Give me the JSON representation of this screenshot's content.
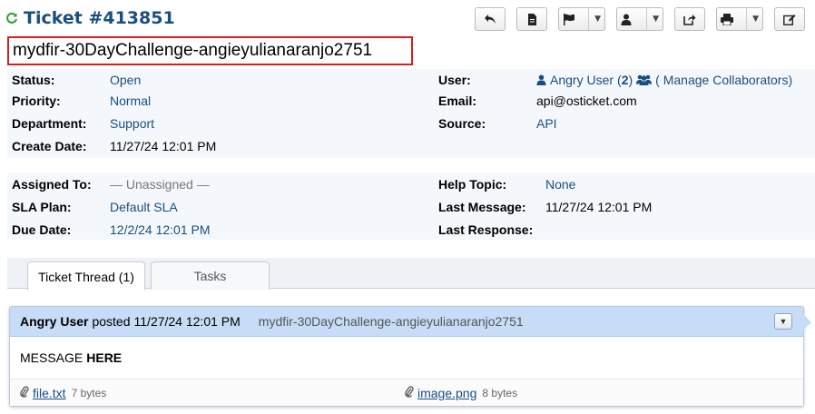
{
  "header": {
    "ticket_number": "Ticket #413851",
    "subject": "mydfir-30DayChallenge-angieyulianaranjo2751"
  },
  "info_left": [
    {
      "label": "Status:",
      "value": "Open"
    },
    {
      "label": "Priority:",
      "value": "Normal"
    },
    {
      "label": "Department:",
      "value": "Support"
    },
    {
      "label": "Create Date:",
      "value": "11/27/24 12:01 PM"
    }
  ],
  "info_right": {
    "user_label": "User:",
    "user_name": "Angry User",
    "collab_count_open": "(",
    "collab_count": "2",
    "collab_count_close": ")",
    "manage_collaborators": "( Manage Collaborators)",
    "email_label": "Email:",
    "email": "api@osticket.com",
    "source_label": "Source:",
    "source": "API"
  },
  "assign_left": [
    {
      "label": "Assigned To:",
      "value": "— Unassigned —"
    },
    {
      "label": "SLA Plan:",
      "value": "Default SLA"
    },
    {
      "label": "Due Date:",
      "value": "12/2/24 12:01 PM"
    }
  ],
  "assign_right": [
    {
      "label": "Help Topic:",
      "value": "None"
    },
    {
      "label": "Last Message:",
      "value": "11/27/24 12:01 PM"
    },
    {
      "label": "Last Response:",
      "value": ""
    }
  ],
  "tabs": [
    {
      "label": "Ticket Thread (1)",
      "active": true
    },
    {
      "label": "Tasks",
      "active": false
    }
  ],
  "thread": {
    "author": "Angry User",
    "posted_label": "posted",
    "posted_at": "11/27/24 12:01 PM",
    "subject": "mydfir-30DayChallenge-angieyulianaranjo2751",
    "body_prefix": "MESSAGE",
    "body_bold": "HERE",
    "attachments": [
      {
        "name": "file.txt",
        "size": "7 bytes"
      },
      {
        "name": "image.png",
        "size": "8 bytes"
      }
    ]
  },
  "colors": {
    "link": "#184e81",
    "subject_border": "#d42020",
    "thread_header": "#c7dcf7",
    "panel_bg": "#f4f8fc"
  }
}
